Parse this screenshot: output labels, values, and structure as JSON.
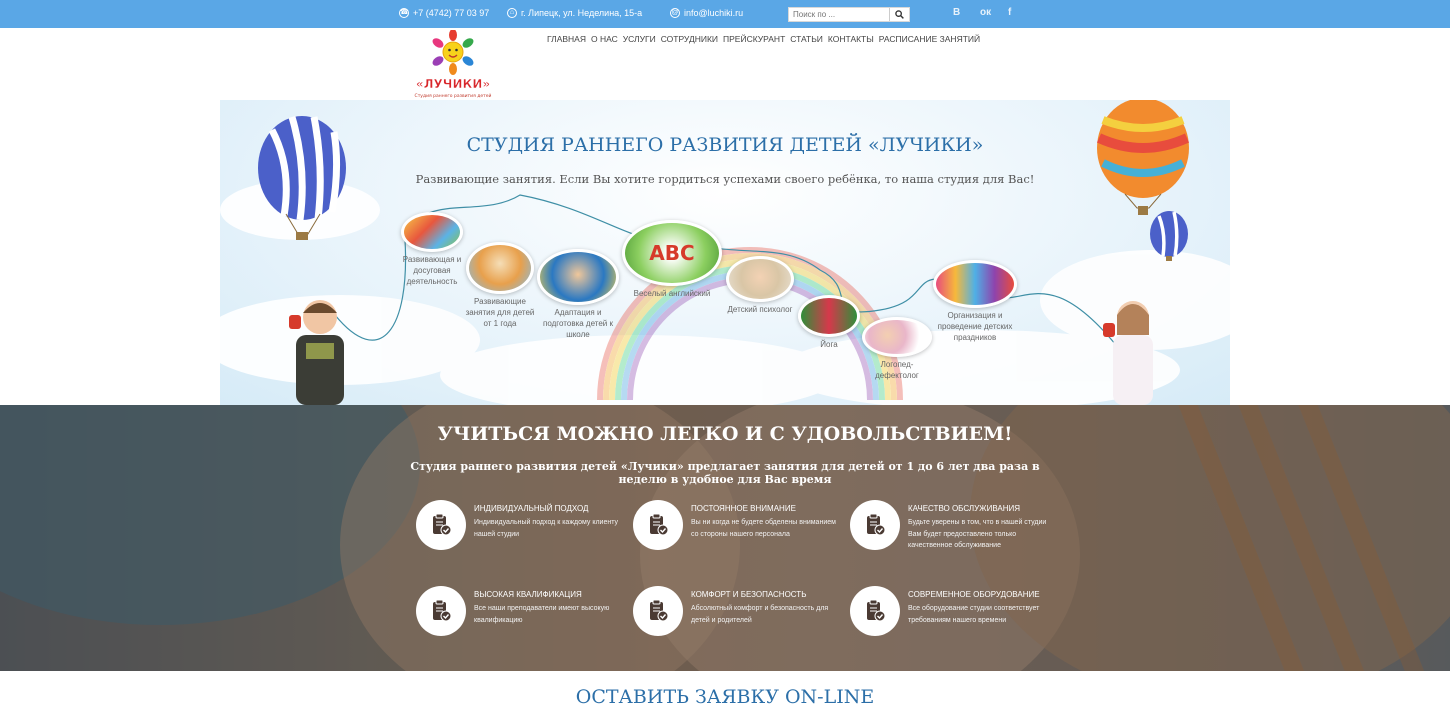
{
  "topbar": {
    "phone": "+7 (4742) 77 03 97",
    "address": "г. Липецк, ул. Неделина, 15-а",
    "email": "info@luchiki.ru",
    "search_placeholder": "Поиск по ...",
    "social": [
      "В",
      "ок",
      "f"
    ]
  },
  "logo": {
    "text": "«ЛУЧИКИ»",
    "tagline": "Студия раннего развития детей"
  },
  "nav": [
    "ГЛАВНАЯ",
    "О НАС",
    "УСЛУГИ",
    "СОТРУДНИКИ",
    "ПРЕЙСКУРАНТ",
    "СТАТЬИ",
    "КОНТАКТЫ",
    "РАСПИСАНИЕ ЗАНЯТИЙ"
  ],
  "hero": {
    "title": "СТУДИЯ РАННЕГО РАЗВИТИЯ ДЕТЕЙ «ЛУЧИКИ»",
    "subtitle": "Развивающие занятия. Если Вы хотите гордиться успехами своего ребёнка, то наша студия для Вас!",
    "services": [
      "Развивающая и досуговая деятельность",
      "Развивающие занятия для детей от 1 года",
      "Адаптация и подготовка детей к школе",
      "Веселый английский",
      "Детский психолог",
      "Йога",
      "Логопед-дефектолог",
      "Организация и проведение детских праздников"
    ],
    "abc": "ABC"
  },
  "features": {
    "title": "УЧИТЬСЯ МОЖНО ЛЕГКО И С УДОВОЛЬСТВИЕМ!",
    "subtitle": "Студия раннего развития детей «Лучики» предлагает занятия для детей от 1 до 6 лет два раза в неделю в удобное для Вас время",
    "items": [
      {
        "title": "ИНДИВИДУАЛЬНЫЙ ПОДХОД",
        "text": "Индивидуальный подход к каждому клиенту нашей студии"
      },
      {
        "title": "ПОСТОЯННОЕ ВНИМАНИЕ",
        "text": "Вы ни когда не будете обделены вниманием со стороны нашего персонала"
      },
      {
        "title": "КАЧЕСТВО ОБСЛУЖИВАНИЯ",
        "text": "Будьте уверены в том, что в нашей студии Вам будет предоставлено только качественное обслуживание"
      },
      {
        "title": "ВЫСОКАЯ КВАЛИФИКАЦИЯ",
        "text": "Все наши преподаватели имеют высокую квалификацию"
      },
      {
        "title": "КОМФОРТ И БЕЗОПАСНОСТЬ",
        "text": "Абсолютный комфорт и безопасность для детей и родителей"
      },
      {
        "title": "СОВРЕМЕННОЕ ОБОРУДОВАНИЕ",
        "text": "Все оборудование студии соответствует требованиям нашего времени"
      }
    ]
  },
  "cta": {
    "title": "ОСТАВИТЬ ЗАЯВКУ ON-LINE"
  },
  "colors": {
    "topbar": "#5aa7e6",
    "heading": "#2c6fa8"
  }
}
